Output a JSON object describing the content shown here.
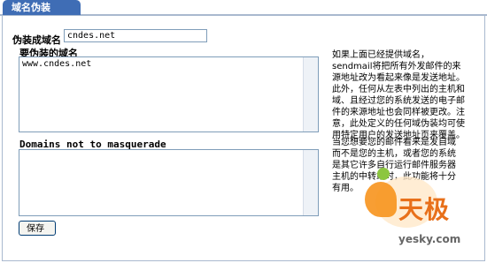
{
  "tab": {
    "label": "域名伪装"
  },
  "masquerade": {
    "label": "伪装成域名",
    "value": "cndes.net"
  },
  "domains_to_masquerade": {
    "label": "要伪装的域名",
    "value": "www.cndes.net"
  },
  "domains_not_to_masquerade": {
    "label": "Domains not to masquerade",
    "value": ""
  },
  "help": {
    "paragraph1": "如果上面已经提供域名，sendmail将把所有外发邮件的来源地址改为看起来像是发送地址。此外，任何从左表中列出的主机和域、且经过您的系统发送的电子邮件的来源地址也会同样被更改。注意，此处定义的任何域伪装均可使用特定用户的发送地址页来覆盖。",
    "paragraph2": "当您想要您的邮件看来是发自域而不是您的主机，或者您的系统是其它许多自行运行邮件服务器主机的中转站时，此功能将十分有用。"
  },
  "save_button": {
    "label": "保存"
  },
  "watermark": {
    "brand": "天极",
    "site": "yesky.com"
  }
}
